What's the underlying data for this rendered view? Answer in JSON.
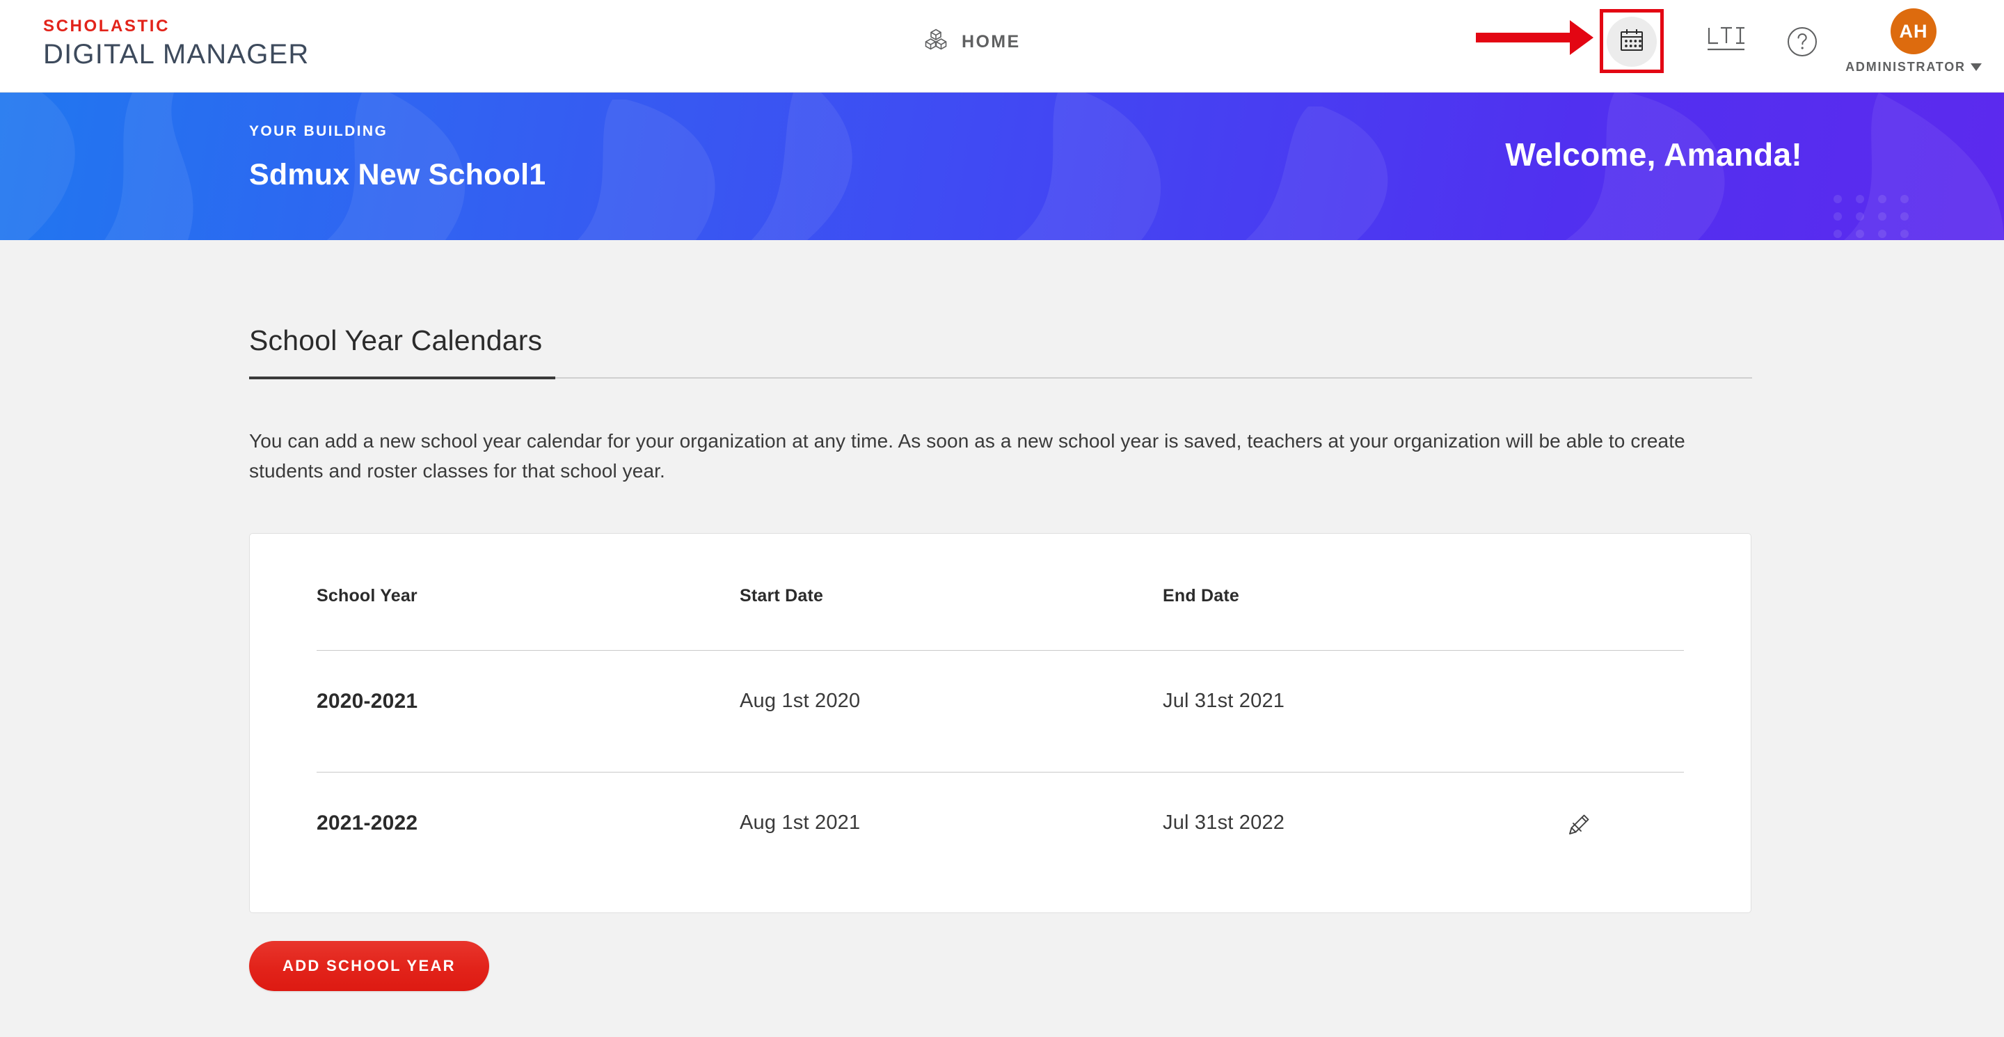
{
  "header": {
    "logo_top": "SCHOLASTIC",
    "logo_bottom": "DIGITAL MANAGER",
    "home_label": "HOME",
    "home_icon": "cubes-icon",
    "calendar_icon": "calendar-icon",
    "lti_label": "LTI",
    "help_icon": "question-mark-icon",
    "avatar_initials": "AH",
    "role_label": "ADMINISTRATOR",
    "caret_icon": "chevron-down-icon"
  },
  "annotation": {
    "arrow_icon": "red-arrow-right",
    "highlight_color": "#e30613",
    "target": "calendar-icon"
  },
  "hero": {
    "eyebrow": "YOUR BUILDING",
    "building_name": "Sdmux New School1",
    "welcome": "Welcome, Amanda!",
    "gradient_start": "#2077ef",
    "gradient_end": "#5c2aee"
  },
  "main": {
    "page_title": "School Year Calendars",
    "intro": "You can add a new school year calendar for your organization at any time. As soon as a new school year is saved, teachers at your organization will be able to create students and roster classes for that school year."
  },
  "table": {
    "columns": [
      "School Year",
      "Start Date",
      "End Date"
    ],
    "rows": [
      {
        "school_year": "2020-2021",
        "start_date": "Aug 1st 2020",
        "end_date": "Jul 31st 2021",
        "has_edit": false
      },
      {
        "school_year": "2021-2022",
        "start_date": "Aug 1st 2021",
        "end_date": "Jul 31st 2022",
        "has_edit": true,
        "edit_icon": "pencil-icon"
      }
    ]
  },
  "actions": {
    "add_school_year": "ADD SCHOOL YEAR",
    "button_color": "#e2231a"
  }
}
